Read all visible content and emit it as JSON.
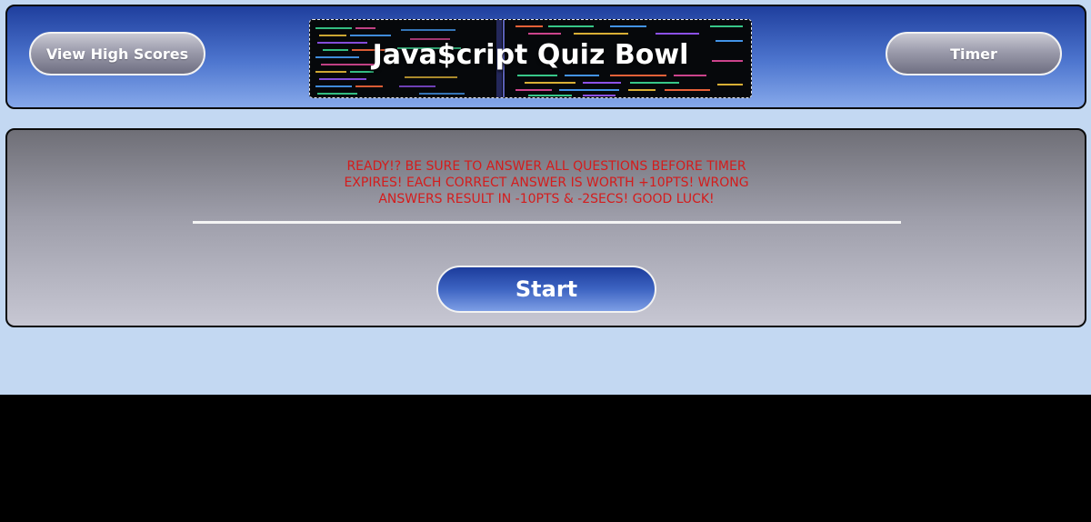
{
  "header": {
    "high_scores_label": "View High Scores",
    "timer_label": "Timer",
    "title": "Java$cript Quiz Bowl"
  },
  "main": {
    "instructions": "Ready!? Be sure to answer all questions before timer expires! Each correct answer is worth +10pts! Wrong answers result in -10pts & -2secs! Good luck!",
    "start_label": "Start"
  },
  "colors": {
    "page_background": "#c3d8f2",
    "header_gradient_top": "#1f3f9e",
    "instruction_text": "#d41c1c",
    "start_button": "#3d64c2",
    "pill_button": "#9b9bab"
  },
  "icons": {
    "banner_image": "code-screen-image"
  }
}
